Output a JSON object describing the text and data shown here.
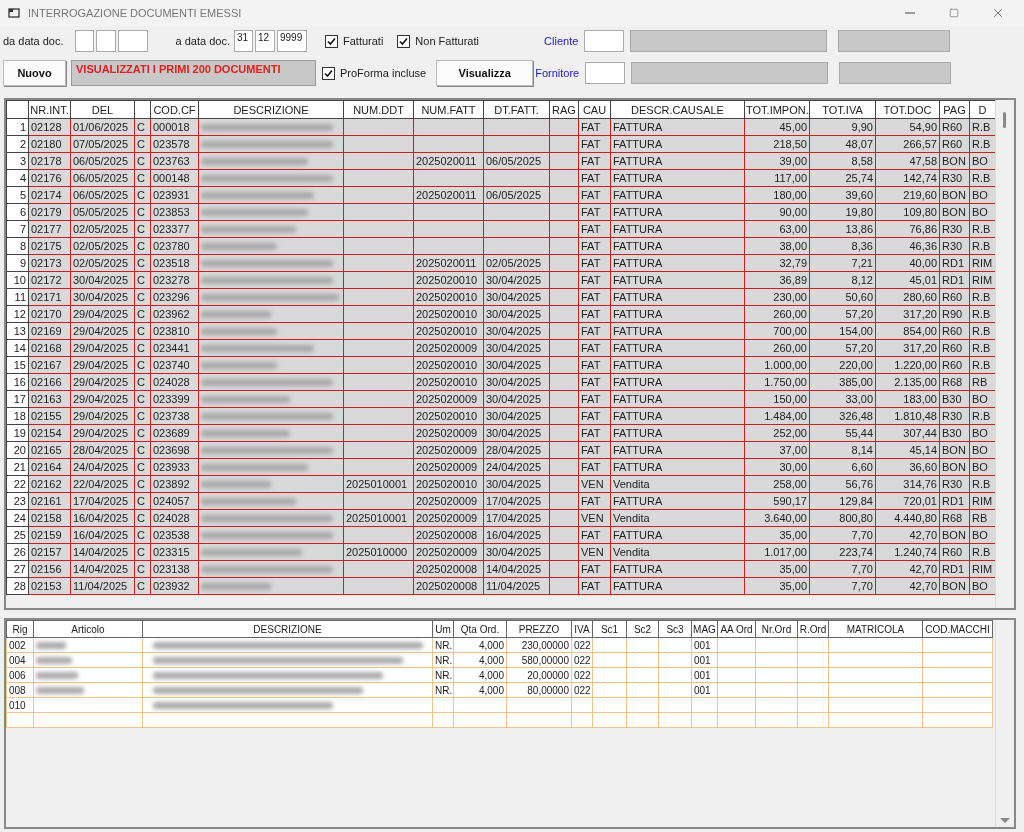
{
  "window": {
    "title": "INTERROGAZIONE DOCUMENTI EMESSI"
  },
  "filters": {
    "from_label": "da data doc.",
    "to_label": "a data doc.",
    "to_day": "31",
    "to_month": "12",
    "to_year": "9999",
    "fatturati": {
      "label": "Fatturati",
      "checked": true
    },
    "non_fatturati": {
      "label": "Non Fatturati",
      "checked": true
    },
    "proforma": {
      "label": "ProForma incluse",
      "checked": true
    },
    "cliente_label": "Cliente",
    "fornitore_label": "Fornitore"
  },
  "buttons": {
    "nuovo": "Nuovo",
    "visualizza": "Visualizza"
  },
  "message": "VISUALIZZATI I PRIMI 200 DOCUMENTI",
  "documents": {
    "columns": [
      "NR.INT.",
      "DEL",
      "COD.CF",
      "DESCRIZIONE",
      "NUM.DDT",
      "NUM.FATT",
      "DT.FATT.",
      "RAG",
      "CAU",
      "DESCR.CAUSALE",
      "TOT.IMPON.",
      "TOT.IVA",
      "TOT.DOC",
      "PAG",
      "D"
    ],
    "rows": [
      {
        "n": "1",
        "nr": "02128",
        "del": "01/06/2025",
        "t": "C",
        "cf": "000018",
        "blur": true,
        "cau": "FAT",
        "caus": "FATTURA",
        "imp": "45,00",
        "iva": "9,90",
        "doc": "54,90",
        "pag": "R60",
        "d": "R.B"
      },
      {
        "n": "2",
        "nr": "02180",
        "del": "07/05/2025",
        "t": "C",
        "cf": "023578",
        "blur": true,
        "cau": "FAT",
        "caus": "FATTURA",
        "imp": "218,50",
        "iva": "48,07",
        "doc": "266,57",
        "pag": "R60",
        "d": "R.B"
      },
      {
        "n": "3",
        "nr": "02178",
        "del": "06/05/2025",
        "t": "C",
        "cf": "023763",
        "blur": true,
        "fatt": "2025020011",
        "dtf": "06/05/2025",
        "cau": "FAT",
        "caus": "FATTURA",
        "imp": "39,00",
        "iva": "8,58",
        "doc": "47,58",
        "pag": "BON",
        "d": "BO"
      },
      {
        "n": "4",
        "nr": "02176",
        "del": "06/05/2025",
        "t": "C",
        "cf": "000148",
        "blur": true,
        "cau": "FAT",
        "caus": "FATTURA",
        "imp": "117,00",
        "iva": "25,74",
        "doc": "142,74",
        "pag": "R30",
        "d": "R.B"
      },
      {
        "n": "5",
        "nr": "02174",
        "del": "06/05/2025",
        "t": "C",
        "cf": "023931",
        "blur": true,
        "fatt": "2025020011",
        "dtf": "06/05/2025",
        "cau": "FAT",
        "caus": "FATTURA",
        "imp": "180,00",
        "iva": "39,60",
        "doc": "219,60",
        "pag": "BON",
        "d": "BO"
      },
      {
        "n": "6",
        "nr": "02179",
        "del": "05/05/2025",
        "t": "C",
        "cf": "023853",
        "blur": true,
        "cau": "FAT",
        "caus": "FATTURA",
        "imp": "90,00",
        "iva": "19,80",
        "doc": "109,80",
        "pag": "BON",
        "d": "BO"
      },
      {
        "n": "7",
        "nr": "02177",
        "del": "02/05/2025",
        "t": "C",
        "cf": "023377",
        "blur": true,
        "cau": "FAT",
        "caus": "FATTURA",
        "imp": "63,00",
        "iva": "13,86",
        "doc": "76,86",
        "pag": "R30",
        "d": "R.B"
      },
      {
        "n": "8",
        "nr": "02175",
        "del": "02/05/2025",
        "t": "C",
        "cf": "023780",
        "blur": true,
        "cau": "FAT",
        "caus": "FATTURA",
        "imp": "38,00",
        "iva": "8,36",
        "doc": "46,36",
        "pag": "R30",
        "d": "R.B"
      },
      {
        "n": "9",
        "nr": "02173",
        "del": "02/05/2025",
        "t": "C",
        "cf": "023518",
        "blur": true,
        "fatt": "2025020011",
        "dtf": "02/05/2025",
        "cau": "FAT",
        "caus": "FATTURA",
        "imp": "32,79",
        "iva": "7,21",
        "doc": "40,00",
        "pag": "RD1",
        "d": "RIM"
      },
      {
        "n": "10",
        "nr": "02172",
        "del": "30/04/2025",
        "t": "C",
        "cf": "023278",
        "blur": true,
        "fatt": "2025020010",
        "dtf": "30/04/2025",
        "cau": "FAT",
        "caus": "FATTURA",
        "imp": "36,89",
        "iva": "8,12",
        "doc": "45,01",
        "pag": "RD1",
        "d": "RIM"
      },
      {
        "n": "11",
        "nr": "02171",
        "del": "30/04/2025",
        "t": "C",
        "cf": "023296",
        "blur": true,
        "fatt": "2025020010",
        "dtf": "30/04/2025",
        "cau": "FAT",
        "caus": "FATTURA",
        "imp": "230,00",
        "iva": "50,60",
        "doc": "280,60",
        "pag": "R60",
        "d": "R.B"
      },
      {
        "n": "12",
        "nr": "02170",
        "del": "29/04/2025",
        "t": "C",
        "cf": "023962",
        "blur": true,
        "fatt": "2025020010",
        "dtf": "30/04/2025",
        "cau": "FAT",
        "caus": "FATTURA",
        "imp": "260,00",
        "iva": "57,20",
        "doc": "317,20",
        "pag": "R90",
        "d": "R.B"
      },
      {
        "n": "13",
        "nr": "02169",
        "del": "29/04/2025",
        "t": "C",
        "cf": "023810",
        "blur": true,
        "fatt": "2025020010",
        "dtf": "30/04/2025",
        "cau": "FAT",
        "caus": "FATTURA",
        "imp": "700,00",
        "iva": "154,00",
        "doc": "854,00",
        "pag": "R60",
        "d": "R.B"
      },
      {
        "n": "14",
        "nr": "02168",
        "del": "29/04/2025",
        "t": "C",
        "cf": "023441",
        "blur": true,
        "fatt": "2025020009",
        "dtf": "30/04/2025",
        "cau": "FAT",
        "caus": "FATTURA",
        "imp": "260,00",
        "iva": "57,20",
        "doc": "317,20",
        "pag": "R60",
        "d": "R.B"
      },
      {
        "n": "15",
        "nr": "02167",
        "del": "29/04/2025",
        "t": "C",
        "cf": "023740",
        "blur": true,
        "fatt": "2025020010",
        "dtf": "30/04/2025",
        "cau": "FAT",
        "caus": "FATTURA",
        "imp": "1.000,00",
        "iva": "220,00",
        "doc": "1.220,00",
        "pag": "R60",
        "d": "R.B"
      },
      {
        "n": "16",
        "nr": "02166",
        "del": "29/04/2025",
        "t": "C",
        "cf": "024028",
        "blur": true,
        "fatt": "2025020010",
        "dtf": "30/04/2025",
        "cau": "FAT",
        "caus": "FATTURA",
        "imp": "1.750,00",
        "iva": "385,00",
        "doc": "2.135,00",
        "pag": "R68",
        "d": "RB"
      },
      {
        "n": "17",
        "nr": "02163",
        "del": "29/04/2025",
        "t": "C",
        "cf": "023399",
        "blur": true,
        "fatt": "2025020009",
        "dtf": "30/04/2025",
        "cau": "FAT",
        "caus": "FATTURA",
        "imp": "150,00",
        "iva": "33,00",
        "doc": "183,00",
        "pag": "B30",
        "d": "BO"
      },
      {
        "n": "18",
        "nr": "02155",
        "del": "29/04/2025",
        "t": "C",
        "cf": "023738",
        "blur": true,
        "fatt": "2025020010",
        "dtf": "30/04/2025",
        "cau": "FAT",
        "caus": "FATTURA",
        "imp": "1.484,00",
        "iva": "326,48",
        "doc": "1.810,48",
        "pag": "R30",
        "d": "R.B"
      },
      {
        "n": "19",
        "nr": "02154",
        "del": "29/04/2025",
        "t": "C",
        "cf": "023689",
        "blur": true,
        "fatt": "2025020009",
        "dtf": "30/04/2025",
        "cau": "FAT",
        "caus": "FATTURA",
        "imp": "252,00",
        "iva": "55,44",
        "doc": "307,44",
        "pag": "B30",
        "d": "BO"
      },
      {
        "n": "20",
        "nr": "02165",
        "del": "28/04/2025",
        "t": "C",
        "cf": "023698",
        "blur": true,
        "fatt": "2025020009",
        "dtf": "28/04/2025",
        "cau": "FAT",
        "caus": "FATTURA",
        "imp": "37,00",
        "iva": "8,14",
        "doc": "45,14",
        "pag": "BON",
        "d": "BO"
      },
      {
        "n": "21",
        "nr": "02164",
        "del": "24/04/2025",
        "t": "C",
        "cf": "023933",
        "blur": true,
        "fatt": "2025020009",
        "dtf": "24/04/2025",
        "cau": "FAT",
        "caus": "FATTURA",
        "imp": "30,00",
        "iva": "6,60",
        "doc": "36,60",
        "pag": "BON",
        "d": "BO"
      },
      {
        "n": "22",
        "nr": "02162",
        "del": "22/04/2025",
        "t": "C",
        "cf": "023892",
        "blur": true,
        "ddt": "2025010001",
        "fatt": "2025020010",
        "dtf": "30/04/2025",
        "cau": "VEN",
        "caus": "Vendita",
        "imp": "258,00",
        "iva": "56,76",
        "doc": "314,76",
        "pag": "R30",
        "d": "R.B"
      },
      {
        "n": "23",
        "nr": "02161",
        "del": "17/04/2025",
        "t": "C",
        "cf": "024057",
        "blur": true,
        "fatt": "2025020009",
        "dtf": "17/04/2025",
        "cau": "FAT",
        "caus": "FATTURA",
        "imp": "590,17",
        "iva": "129,84",
        "doc": "720,01",
        "pag": "RD1",
        "d": "RIM"
      },
      {
        "n": "24",
        "nr": "02158",
        "del": "16/04/2025",
        "t": "C",
        "cf": "024028",
        "blur": true,
        "ddt": "2025010001",
        "fatt": "2025020009",
        "dtf": "17/04/2025",
        "cau": "VEN",
        "caus": "Vendita",
        "imp": "3.640,00",
        "iva": "800,80",
        "doc": "4.440,80",
        "pag": "R68",
        "d": "RB"
      },
      {
        "n": "25",
        "nr": "02159",
        "del": "16/04/2025",
        "t": "C",
        "cf": "023538",
        "blur": true,
        "fatt": "2025020008",
        "dtf": "16/04/2025",
        "cau": "FAT",
        "caus": "FATTURA",
        "imp": "35,00",
        "iva": "7,70",
        "doc": "42,70",
        "pag": "BON",
        "d": "BO"
      },
      {
        "n": "26",
        "nr": "02157",
        "del": "14/04/2025",
        "t": "C",
        "cf": "023315",
        "blur": true,
        "ddt": "2025010000",
        "fatt": "2025020009",
        "dtf": "30/04/2025",
        "cau": "VEN",
        "caus": "Vendita",
        "imp": "1.017,00",
        "iva": "223,74",
        "doc": "1.240,74",
        "pag": "R60",
        "d": "R.B"
      },
      {
        "n": "27",
        "nr": "02156",
        "del": "14/04/2025",
        "t": "C",
        "cf": "023138",
        "blur": true,
        "fatt": "2025020008",
        "dtf": "14/04/2025",
        "cau": "FAT",
        "caus": "FATTURA",
        "imp": "35,00",
        "iva": "7,70",
        "doc": "42,70",
        "pag": "RD1",
        "d": "RIM"
      },
      {
        "n": "28",
        "nr": "02153",
        "del": "11/04/2025",
        "t": "C",
        "cf": "023932",
        "blur": true,
        "fatt": "2025020008",
        "dtf": "11/04/2025",
        "cau": "FAT",
        "caus": "FATTURA",
        "imp": "35,00",
        "iva": "7,70",
        "doc": "42,70",
        "pag": "BON",
        "d": "BO"
      }
    ]
  },
  "lines": {
    "columns": [
      "Rig",
      "Articolo",
      "DESCRIZIONE",
      "Um",
      "Qta Ord.",
      "PREZZO",
      "IVA",
      "Sc1",
      "Sc2",
      "Sc3",
      "MAG",
      "AA Ord",
      "Nr.Ord",
      "R.Ord",
      "MATRICOLA",
      "COD.MACCHI"
    ],
    "rows": [
      {
        "rig": "002",
        "art_blur": true,
        "desc_blur": true,
        "um": "NR.",
        "qta": "4,000",
        "prezzo": "230,00000",
        "iva": "022",
        "mag": "001"
      },
      {
        "rig": "004",
        "art_blur": true,
        "desc_blur": true,
        "um": "NR.",
        "qta": "4,000",
        "prezzo": "580,00000",
        "iva": "022",
        "mag": "001"
      },
      {
        "rig": "006",
        "art_blur": true,
        "desc_blur": true,
        "um": "NR.",
        "qta": "4,000",
        "prezzo": "20,00000",
        "iva": "022",
        "mag": "001"
      },
      {
        "rig": "008",
        "art_blur": true,
        "desc_blur": true,
        "um": "NR.",
        "qta": "4,000",
        "prezzo": "80,00000",
        "iva": "022",
        "mag": "001"
      },
      {
        "rig": "010",
        "desc_blur": true
      },
      {}
    ]
  }
}
